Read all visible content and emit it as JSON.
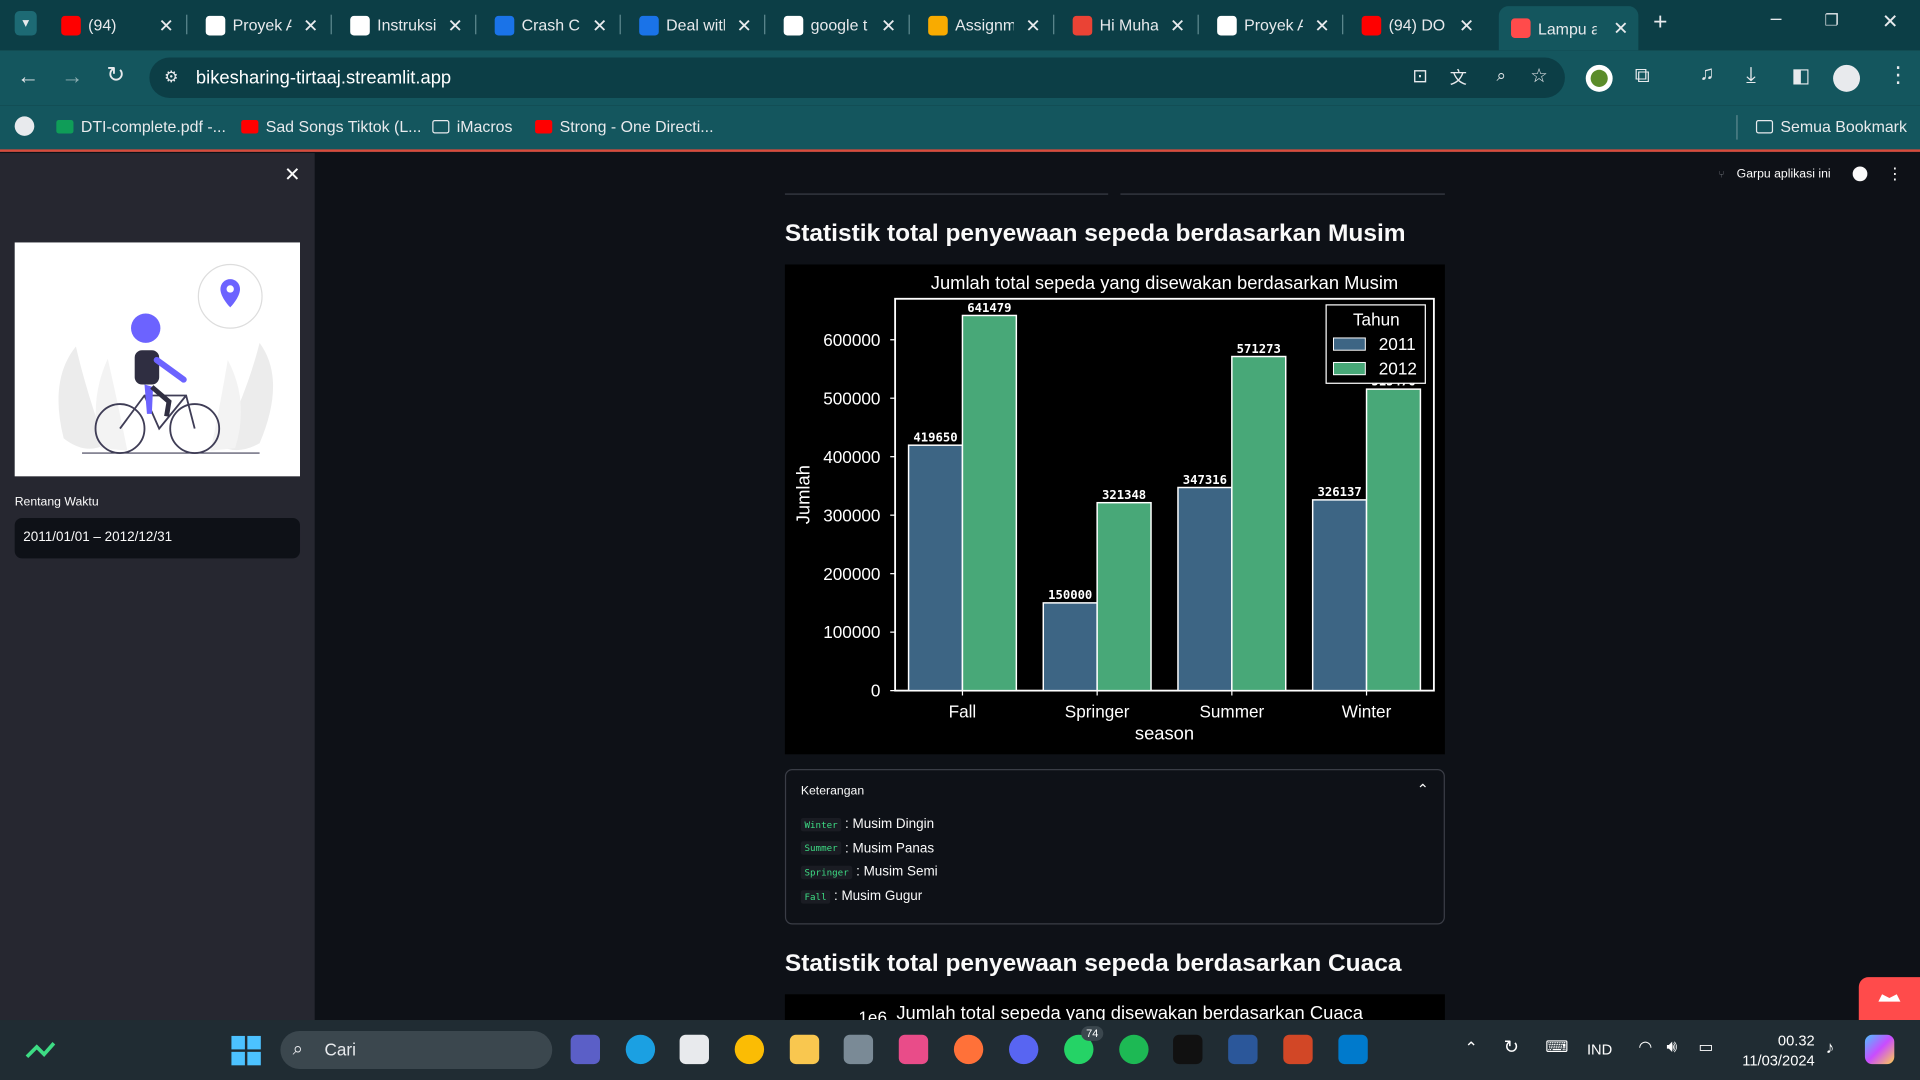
{
  "browser": {
    "tabs": [
      {
        "title": "(94)",
        "icon": "youtube-icon",
        "color": "#ff0000"
      },
      {
        "title": "Proyek A",
        "icon": "dicoding-icon",
        "color": "#ffffff"
      },
      {
        "title": "Instruksi",
        "icon": "dicoding-icon",
        "color": "#ffffff"
      },
      {
        "title": "Crash Co",
        "icon": "c-icon",
        "color": "#1a73e8"
      },
      {
        "title": "Deal with",
        "icon": "c-icon",
        "color": "#1a73e8"
      },
      {
        "title": "google t",
        "icon": "google-icon",
        "color": "#ffffff"
      },
      {
        "title": "Assignm",
        "icon": "classroom-icon",
        "color": "#f9ab00"
      },
      {
        "title": "Hi Muha",
        "icon": "gmail-icon",
        "color": "#ea4335"
      },
      {
        "title": "Proyek A",
        "icon": "dicoding-icon",
        "color": "#ffffff"
      },
      {
        "title": "(94) DO",
        "icon": "youtube-icon",
        "color": "#ff0000"
      },
      {
        "title": "Lampu a",
        "icon": "streamlit-icon",
        "color": "#ff4b4b"
      }
    ],
    "url": "bikesharing-tirtaaj.streamlit.app",
    "bookmarks": [
      {
        "label": "DTI-complete.pdf -...",
        "icon": "drive-icon",
        "color": "#0f9d58"
      },
      {
        "label": "Sad Songs Tiktok (L...",
        "icon": "youtube-icon",
        "color": "#ff0000"
      },
      {
        "label": "iMacros",
        "icon": "folder-icon",
        "color": "#e8eaed"
      },
      {
        "label": "Strong - One Directi...",
        "icon": "youtube-icon",
        "color": "#ff0000"
      }
    ],
    "all_bookmarks": "Semua Bookmark"
  },
  "sidebar": {
    "range_label": "Rentang Waktu",
    "range_value": "2011/01/01 – 2012/12/31"
  },
  "header": {
    "fork_label": "Garpu aplikasi ini"
  },
  "main": {
    "section1_title": "Statistik total penyewaan sepeda berdasarkan Musim",
    "expander": {
      "title": "Keterangan",
      "items": [
        {
          "code": "Winter",
          "desc": ": Musim Dingin"
        },
        {
          "code": "Summer",
          "desc": ": Musim Panas"
        },
        {
          "code": "Springer",
          "desc": ": Musim Semi"
        },
        {
          "code": "Fall",
          "desc": ": Musim Gugur"
        }
      ]
    },
    "section2_title": "Statistik total penyewaan sepeda berdasarkan Cuaca",
    "chart2_title": "Jumlah total sepeda yang disewakan berdasarkan Cuaca",
    "chart2_exp": "1e6"
  },
  "chart_data": {
    "type": "bar",
    "title": "Jumlah total sepeda yang disewakan berdasarkan Musim",
    "xlabel": "season",
    "ylabel": "Jumlah",
    "categories": [
      "Fall",
      "Springer",
      "Summer",
      "Winter"
    ],
    "series": [
      {
        "name": "2011",
        "values": [
          419650,
          150000,
          347316,
          326137
        ],
        "color": "#3d6584"
      },
      {
        "name": "2012",
        "values": [
          641479,
          321348,
          571273,
          515476
        ],
        "color": "#48a878"
      }
    ],
    "bar_labels": [
      [
        "419650",
        "150000",
        "347316",
        "326137"
      ],
      [
        "641479",
        "321348",
        "571273",
        "515476"
      ]
    ],
    "ylim": [
      0,
      670000
    ],
    "yticks": [
      0,
      100000,
      200000,
      300000,
      400000,
      500000,
      600000
    ],
    "legend_title": "Tahun",
    "legend_position": "top-right",
    "grid": false
  },
  "taskbar": {
    "search_label": "Cari",
    "time": "00.32",
    "date": "11/03/2024",
    "lang": "IND",
    "whatsapp_badge": "74"
  }
}
